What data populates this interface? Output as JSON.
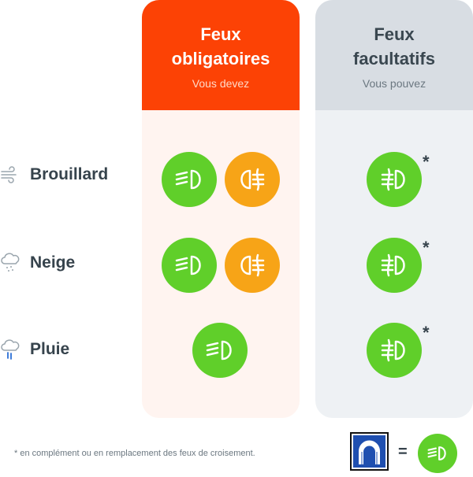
{
  "columns": {
    "mandatory": {
      "title": "Feux obligatoires",
      "subtitle": "Vous devez"
    },
    "optional": {
      "title": "Feux facultatifs",
      "subtitle": "Vous pouvez"
    }
  },
  "rows": [
    {
      "label": "Brouillard",
      "icon": "wind-icon",
      "mandatory_lights": [
        "dipped-beam",
        "rear-fog"
      ],
      "optional_lights": [
        "front-fog"
      ],
      "asterisk": "*"
    },
    {
      "label": "Neige",
      "icon": "snow-cloud-icon",
      "mandatory_lights": [
        "dipped-beam",
        "rear-fog"
      ],
      "optional_lights": [
        "front-fog"
      ],
      "asterisk": "*"
    },
    {
      "label": "Pluie",
      "icon": "rain-cloud-icon",
      "mandatory_lights": [
        "dipped-beam"
      ],
      "optional_lights": [
        "front-fog"
      ],
      "asterisk": "*"
    }
  ],
  "footnote": "* en complément ou en remplacement des feux de croisement.",
  "legend": {
    "sign": "tunnel-sign-icon",
    "equals": "=",
    "light": "dipped-beam"
  },
  "colors": {
    "mandatory_header": "#fc4205",
    "mandatory_body": "#fff4f0",
    "optional_header": "#d8dde3",
    "optional_body": "#eef1f4",
    "green_lamp": "#60cf2a",
    "orange_lamp": "#f7a417"
  }
}
